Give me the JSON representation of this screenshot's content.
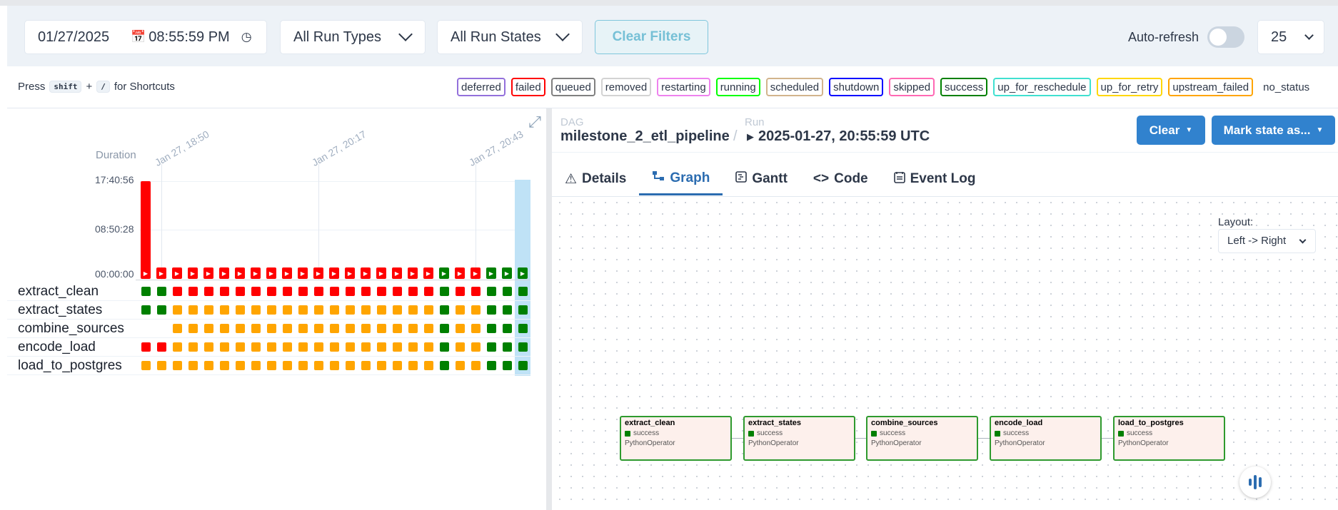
{
  "filters": {
    "date": "01/27/2025",
    "time": "08:55:59  PM",
    "run_types": "All Run Types",
    "run_states": "All Run States",
    "clear_filters": "Clear Filters",
    "auto_refresh": "Auto-refresh",
    "page_size": "25"
  },
  "shortcuts": {
    "press": "Press",
    "key1": "shift",
    "plus": "+",
    "key2": "/",
    "suffix": "for Shortcuts"
  },
  "legend": [
    {
      "label": "deferred",
      "color": "#9370db"
    },
    {
      "label": "failed",
      "color": "#ff0000"
    },
    {
      "label": "queued",
      "color": "#808080"
    },
    {
      "label": "removed",
      "color": "#d3d3d3"
    },
    {
      "label": "restarting",
      "color": "#ee82ee"
    },
    {
      "label": "running",
      "color": "#00ff00"
    },
    {
      "label": "scheduled",
      "color": "#d2b48c"
    },
    {
      "label": "shutdown",
      "color": "#0000ff"
    },
    {
      "label": "skipped",
      "color": "#ff69b4"
    },
    {
      "label": "success",
      "color": "#008000"
    },
    {
      "label": "up_for_reschedule",
      "color": "#40e0d0"
    },
    {
      "label": "up_for_retry",
      "color": "#ffd700"
    },
    {
      "label": "upstream_failed",
      "color": "#ffa500"
    },
    {
      "label": "no_status",
      "color": "transparent"
    }
  ],
  "grid": {
    "duration_label": "Duration",
    "y_ticks": [
      "17:40:56",
      "08:50:28",
      "00:00:00"
    ],
    "x_ticks": [
      "Jan 27, 18:50",
      "Jan 27, 20:17",
      "Jan 27, 20:43"
    ],
    "run_states": [
      "failed",
      "failed",
      "failed",
      "failed",
      "failed",
      "failed",
      "failed",
      "failed",
      "failed",
      "failed",
      "failed",
      "failed",
      "failed",
      "failed",
      "failed",
      "failed",
      "failed",
      "failed",
      "failed",
      "success",
      "failed",
      "failed",
      "success",
      "success",
      "success"
    ],
    "run_durations_rel": [
      1.0,
      0.07,
      0.07,
      0.07,
      0.07,
      0.07,
      0.07,
      0.07,
      0.07,
      0.07,
      0.07,
      0.07,
      0.07,
      0.07,
      0.07,
      0.07,
      0.07,
      0.07,
      0.07,
      0.07,
      0.07,
      0.07,
      0.07,
      0.07,
      0.07
    ],
    "tasks": [
      {
        "name": "extract_clean",
        "states": [
          "success",
          "success",
          "failed",
          "failed",
          "failed",
          "failed",
          "failed",
          "failed",
          "failed",
          "failed",
          "failed",
          "failed",
          "failed",
          "failed",
          "failed",
          "failed",
          "failed",
          "failed",
          "failed",
          "success",
          "failed",
          "failed",
          "success",
          "success",
          "success"
        ]
      },
      {
        "name": "extract_states",
        "states": [
          "success",
          "success",
          "upstream_failed",
          "upstream_failed",
          "upstream_failed",
          "upstream_failed",
          "upstream_failed",
          "upstream_failed",
          "upstream_failed",
          "upstream_failed",
          "upstream_failed",
          "upstream_failed",
          "upstream_failed",
          "upstream_failed",
          "upstream_failed",
          "upstream_failed",
          "upstream_failed",
          "upstream_failed",
          "upstream_failed",
          "success",
          "upstream_failed",
          "upstream_failed",
          "success",
          "success",
          "success"
        ]
      },
      {
        "name": "combine_sources",
        "states": [
          "none",
          "none",
          "upstream_failed",
          "upstream_failed",
          "upstream_failed",
          "upstream_failed",
          "upstream_failed",
          "upstream_failed",
          "upstream_failed",
          "upstream_failed",
          "upstream_failed",
          "upstream_failed",
          "upstream_failed",
          "upstream_failed",
          "upstream_failed",
          "upstream_failed",
          "upstream_failed",
          "upstream_failed",
          "upstream_failed",
          "success",
          "upstream_failed",
          "upstream_failed",
          "success",
          "success",
          "success"
        ]
      },
      {
        "name": "encode_load",
        "states": [
          "failed",
          "failed",
          "upstream_failed",
          "upstream_failed",
          "upstream_failed",
          "upstream_failed",
          "upstream_failed",
          "upstream_failed",
          "upstream_failed",
          "upstream_failed",
          "upstream_failed",
          "upstream_failed",
          "upstream_failed",
          "upstream_failed",
          "upstream_failed",
          "upstream_failed",
          "upstream_failed",
          "upstream_failed",
          "upstream_failed",
          "success",
          "upstream_failed",
          "upstream_failed",
          "success",
          "success",
          "success"
        ]
      },
      {
        "name": "load_to_postgres",
        "states": [
          "upstream_failed",
          "upstream_failed",
          "upstream_failed",
          "upstream_failed",
          "upstream_failed",
          "upstream_failed",
          "upstream_failed",
          "upstream_failed",
          "upstream_failed",
          "upstream_failed",
          "upstream_failed",
          "upstream_failed",
          "upstream_failed",
          "upstream_failed",
          "upstream_failed",
          "upstream_failed",
          "upstream_failed",
          "upstream_failed",
          "upstream_failed",
          "success",
          "upstream_failed",
          "upstream_failed",
          "success",
          "success",
          "success"
        ]
      }
    ]
  },
  "breadcrumb": {
    "dag_label": "DAG",
    "dag_id": "milestone_2_etl_pipeline",
    "sep": "/",
    "run_label": "Run",
    "run_id": "2025-01-27, 20:55:59 UTC"
  },
  "actions": {
    "clear": "Clear",
    "mark_state": "Mark state as..."
  },
  "tabs": [
    {
      "label": "Details",
      "icon": "warning-icon"
    },
    {
      "label": "Graph",
      "icon": "graph-icon"
    },
    {
      "label": "Gantt",
      "icon": "gantt-icon"
    },
    {
      "label": "Code",
      "icon": "code-icon"
    },
    {
      "label": "Event Log",
      "icon": "event-log-icon"
    }
  ],
  "graph": {
    "layout_label": "Layout:",
    "layout_value": "Left -> Right",
    "nodes": [
      {
        "name": "extract_clean",
        "state": "success",
        "operator": "PythonOperator"
      },
      {
        "name": "extract_states",
        "state": "success",
        "operator": "PythonOperator"
      },
      {
        "name": "combine_sources",
        "state": "success",
        "operator": "PythonOperator"
      },
      {
        "name": "encode_load",
        "state": "success",
        "operator": "PythonOperator"
      },
      {
        "name": "load_to_postgres",
        "state": "success",
        "operator": "PythonOperator"
      }
    ]
  },
  "colors": {
    "success": "#008000",
    "failed": "#ff0000",
    "upstream_failed": "#ffa500",
    "accent": "#3182ce"
  }
}
